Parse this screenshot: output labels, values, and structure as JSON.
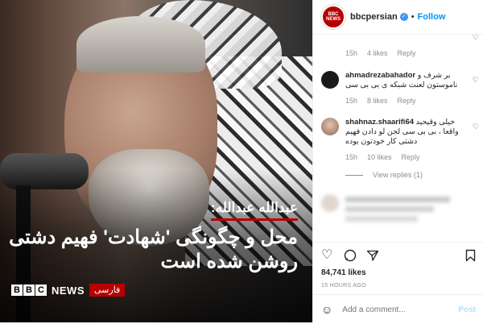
{
  "media": {
    "caption_name": "عبدالله عبدالله:",
    "caption_line1": "محل و چگونگی 'شهادت' فهیم دشتی",
    "caption_line2": "روشن شده است",
    "logo_letters": [
      "B",
      "B",
      "C"
    ],
    "logo_news": "NEWS",
    "logo_tag": "فارسی"
  },
  "header": {
    "avatar_text": "BBC NEWS",
    "username": "bbcpersian",
    "verified_icon": "check",
    "separator": "•",
    "follow_label": "Follow"
  },
  "comments": [
    {
      "username": "",
      "text": "",
      "time": "15h",
      "likes": "4 likes",
      "reply": "Reply",
      "heart_icon": "heart-icon"
    },
    {
      "username": "ahmadrezabahador",
      "text": "بر شرف و ناموستون لعنت شبکه ی بی بی سی",
      "time": "15h",
      "likes": "8 likes",
      "reply": "Reply",
      "heart_icon": "heart-icon"
    },
    {
      "username": "shahnaz.shaarifi64",
      "text": "خیلی وقیحید واقعا ، بی بی سی لجن لو دادن فهیم دشتی کار خودتون بوده",
      "time": "15h",
      "likes": "10 likes",
      "reply": "Reply",
      "view_replies": "View replies (1)",
      "heart_icon": "heart-icon"
    }
  ],
  "actions": {
    "icons": [
      "heart-icon",
      "comment-icon",
      "share-icon"
    ],
    "save_icon": "bookmark-icon",
    "likes_count": "84,741 likes",
    "time_ago": "15 HOURS AGO"
  },
  "add_comment": {
    "emoji_icon": "smiley-icon",
    "placeholder": "Add a comment...",
    "post_label": "Post"
  },
  "colors": {
    "bbc_red": "#b80000",
    "follow_blue": "#0095f6",
    "post_disabled": "#b2dffc"
  }
}
